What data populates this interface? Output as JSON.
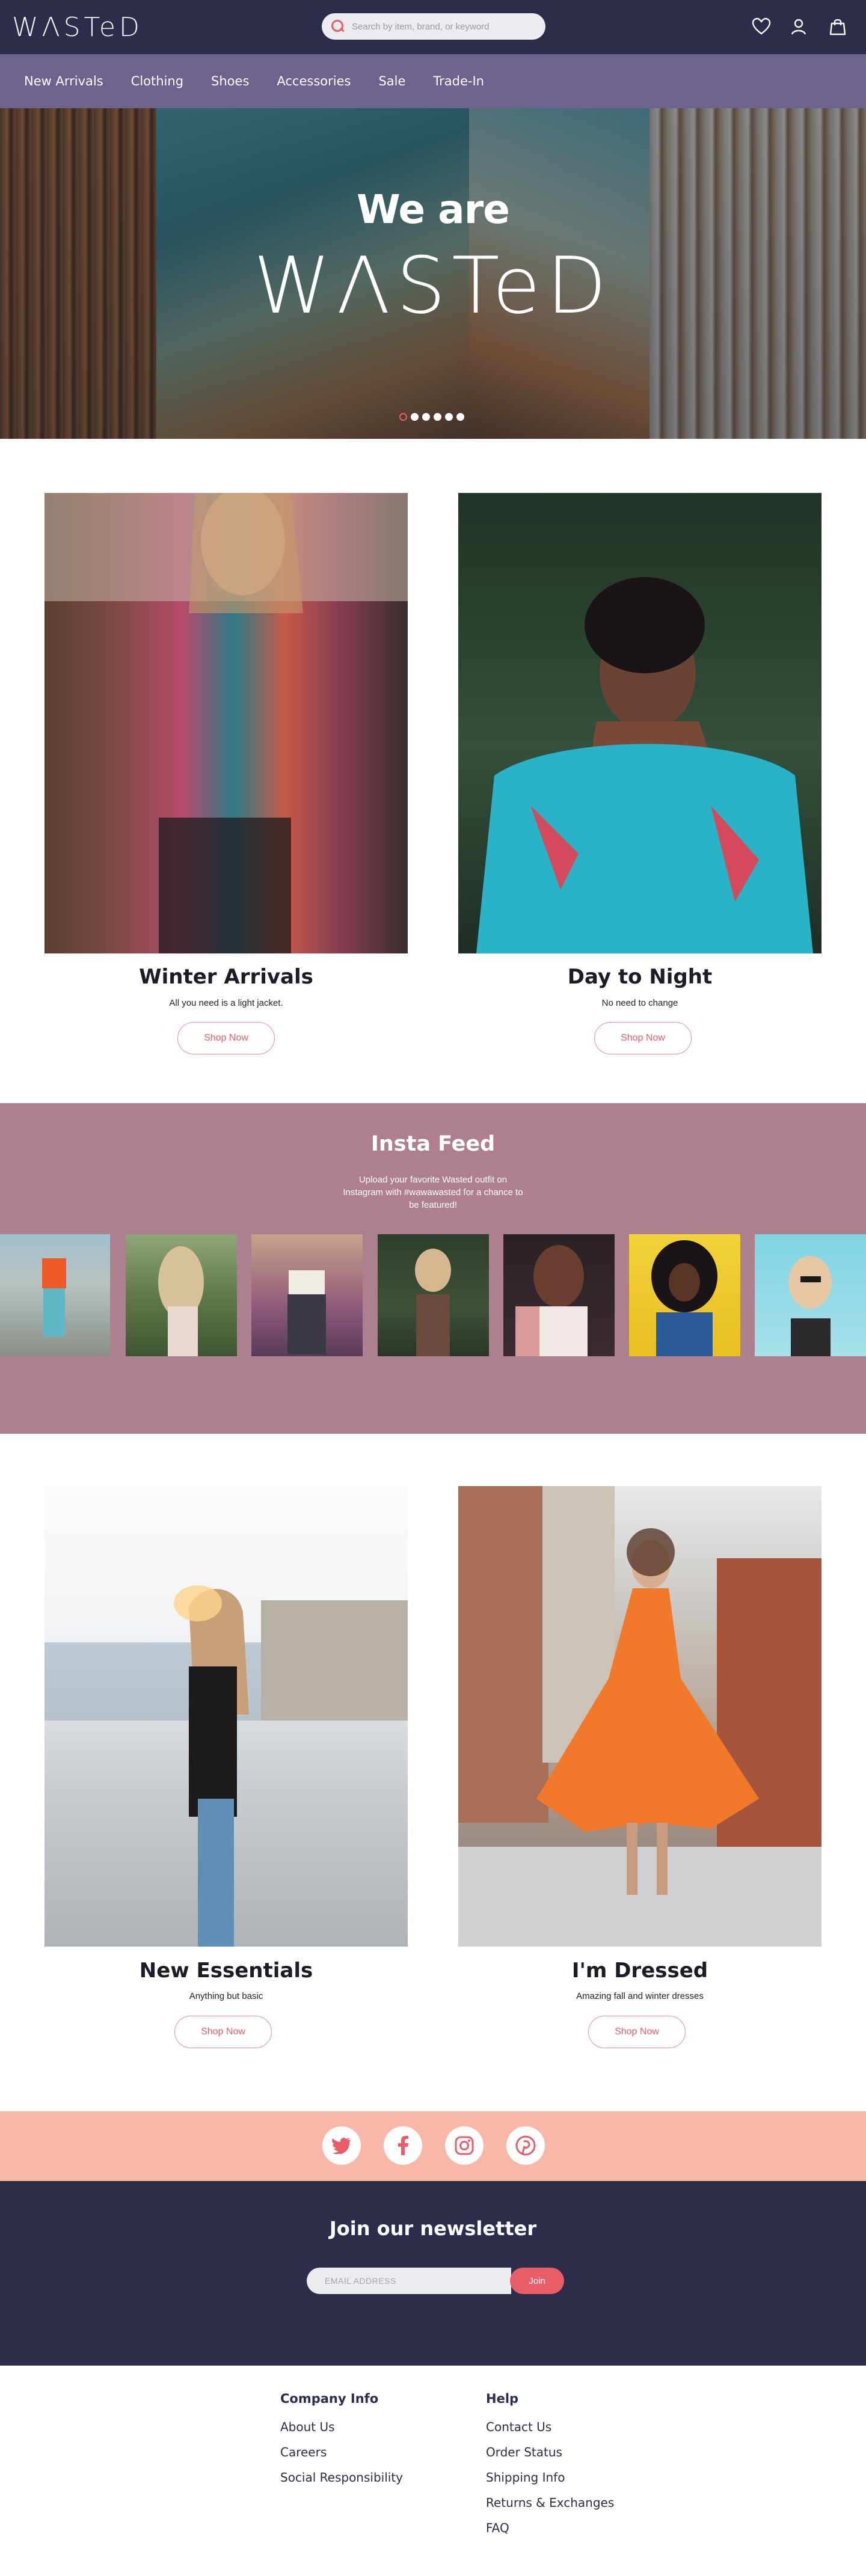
{
  "header": {
    "logo_text": "WΛSTeD",
    "search_placeholder": "Search by item, brand, or keyword",
    "icons": [
      "heart-icon",
      "account-icon",
      "bag-icon"
    ]
  },
  "nav": {
    "items": [
      "New Arrivals",
      "Clothing",
      "Shoes",
      "Accessories",
      "Sale",
      "Trade-In"
    ]
  },
  "hero": {
    "subtitle": "We are",
    "title": "WΛSTeD",
    "slide_count": 6,
    "active_slide": 1
  },
  "features_top": [
    {
      "title": "Winter Arrivals",
      "description": "All you need is a light jacket.",
      "button": "Shop Now"
    },
    {
      "title": "Day to Night",
      "description": "No need to change",
      "button": "Shop Now"
    }
  ],
  "insta": {
    "title": "Insta Feed",
    "description": "Upload your favorite Wasted outfit on Instagram with #wawawasted for a chance to be featured!"
  },
  "features_bottom": [
    {
      "title": "New Essentials",
      "description": "Anything but basic",
      "button": "Shop Now"
    },
    {
      "title": "I'm Dressed",
      "description": "Amazing fall and winter dresses",
      "button": "Shop Now"
    }
  ],
  "social": [
    "twitter-icon",
    "facebook-icon",
    "instagram-icon",
    "pinterest-icon"
  ],
  "newsletter": {
    "title": "Join our newsletter",
    "placeholder": "EMAIL ADDRESS",
    "button": "Join"
  },
  "footer": {
    "columns": [
      {
        "heading": "Company Info",
        "links": [
          "About Us",
          "Careers",
          "Social Responsibility"
        ]
      },
      {
        "heading": "Help",
        "links": [
          "Contact Us",
          "Order Status",
          "Shipping Info",
          "Returns & Exchanges",
          "FAQ"
        ]
      }
    ]
  },
  "colors": {
    "header_bg": "#2b2d4b",
    "nav_bg": "#6e628f",
    "accent": "#e85d68",
    "insta_bg": "#ae808d",
    "social_bg": "#f9b7a8"
  }
}
